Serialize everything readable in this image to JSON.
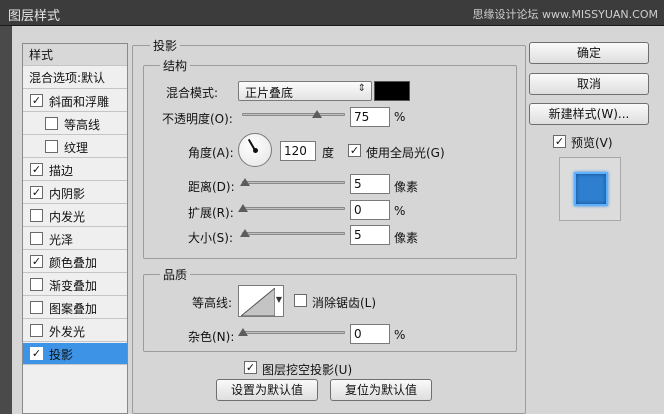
{
  "window": {
    "title": "图层样式",
    "watermark": "思缘设计论坛 www.MISSYUAN.COM"
  },
  "style_list": {
    "header": "样式",
    "blend_options": "混合选项:默认",
    "items": [
      {
        "label": "斜面和浮雕",
        "checked": "✓"
      },
      {
        "label": "等高线",
        "checked": ""
      },
      {
        "label": "纹理",
        "checked": ""
      },
      {
        "label": "描边",
        "checked": "✓"
      },
      {
        "label": "内阴影",
        "checked": "✓"
      },
      {
        "label": "内发光",
        "checked": ""
      },
      {
        "label": "光泽",
        "checked": ""
      },
      {
        "label": "颜色叠加",
        "checked": "✓"
      },
      {
        "label": "渐变叠加",
        "checked": ""
      },
      {
        "label": "图案叠加",
        "checked": ""
      },
      {
        "label": "外发光",
        "checked": ""
      },
      {
        "label": "投影",
        "checked": "✓"
      }
    ]
  },
  "drop_shadow": {
    "section_title": "投影",
    "structure": {
      "title": "结构",
      "blend_mode_label": "混合模式:",
      "blend_mode_value": "正片叠底",
      "shadow_color": "#000000",
      "opacity_label": "不透明度(O):",
      "opacity_value": "75",
      "opacity_unit": "%",
      "opacity_level": 0.75,
      "angle_label": "角度(A):",
      "angle_value": "120",
      "angle_unit": "度",
      "global_light_checked": "✓",
      "global_light_label": "使用全局光(G)",
      "distance_label": "距离(D):",
      "distance_value": "5",
      "distance_unit": "像素",
      "spread_label": "扩展(R):",
      "spread_value": "0",
      "spread_unit": "%",
      "size_label": "大小(S):",
      "size_value": "5",
      "size_unit": "像素"
    },
    "quality": {
      "title": "品质",
      "contour_label": "等高线:",
      "anti_alias_checked": "",
      "anti_alias_label": "消除锯齿(L)",
      "noise_label": "杂色(N):",
      "noise_value": "0",
      "noise_unit": "%"
    },
    "knockout_checked": "✓",
    "knockout_label": "图层挖空投影(U)",
    "make_default": "设置为默认值",
    "reset_default": "复位为默认值"
  },
  "buttons": {
    "ok": "确定",
    "cancel": "取消",
    "new_style": "新建样式(W)...",
    "preview_checked": "✓",
    "preview_label": "预览(V)"
  },
  "colors": {
    "selected_row": "#3d94e6",
    "preview_fill": "#2f7fd0"
  }
}
